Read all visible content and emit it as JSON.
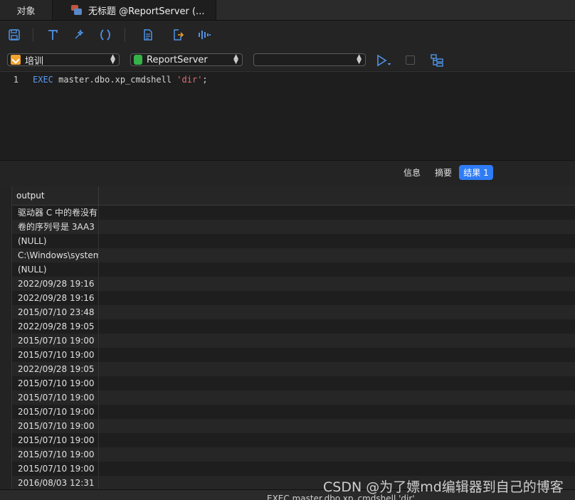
{
  "tabs": {
    "objects": "对象",
    "query": "无标题 @ReportServer (..."
  },
  "selectors": {
    "database": "培训",
    "server": "ReportServer",
    "schema": ""
  },
  "editor": {
    "line_number": "1",
    "keyword": "EXEC",
    "code_rest": " master.dbo.xp_cmdshell ",
    "string_literal": "'dir'",
    "terminator": ";"
  },
  "result_tabs": {
    "info": "信息",
    "summary": "摘要",
    "result": "结果 1"
  },
  "grid": {
    "column": "output",
    "rows": [
      " 驱动器 C 中的卷没有",
      " 卷的序列号是 3AA3",
      "(NULL)",
      " C:\\Windows\\system",
      "(NULL)",
      "2022/09/28  19:16",
      "2022/09/28  19:16",
      "2015/07/10  23:48",
      "2022/09/28  19:05",
      "2015/07/10  19:00",
      "2015/07/10  19:00",
      "2022/09/28  19:05",
      "2015/07/10  19:00",
      "2015/07/10  19:00",
      "2015/07/10  19:00",
      "2015/07/10  19:00",
      "2015/07/10  19:00",
      "2015/07/10  19:00",
      "2015/07/10  19:00",
      "2016/08/03  12:31"
    ]
  },
  "status": {
    "text": "EXEC master.dbo.xp_cmdshell 'dir'"
  },
  "watermark": "CSDN @为了嫖md编辑器到自己的博客",
  "colors": {
    "accent": "#2f7cf6",
    "icon_blue": "#4f93e6",
    "keyword": "#5b9bf0",
    "string": "#e06c75"
  }
}
